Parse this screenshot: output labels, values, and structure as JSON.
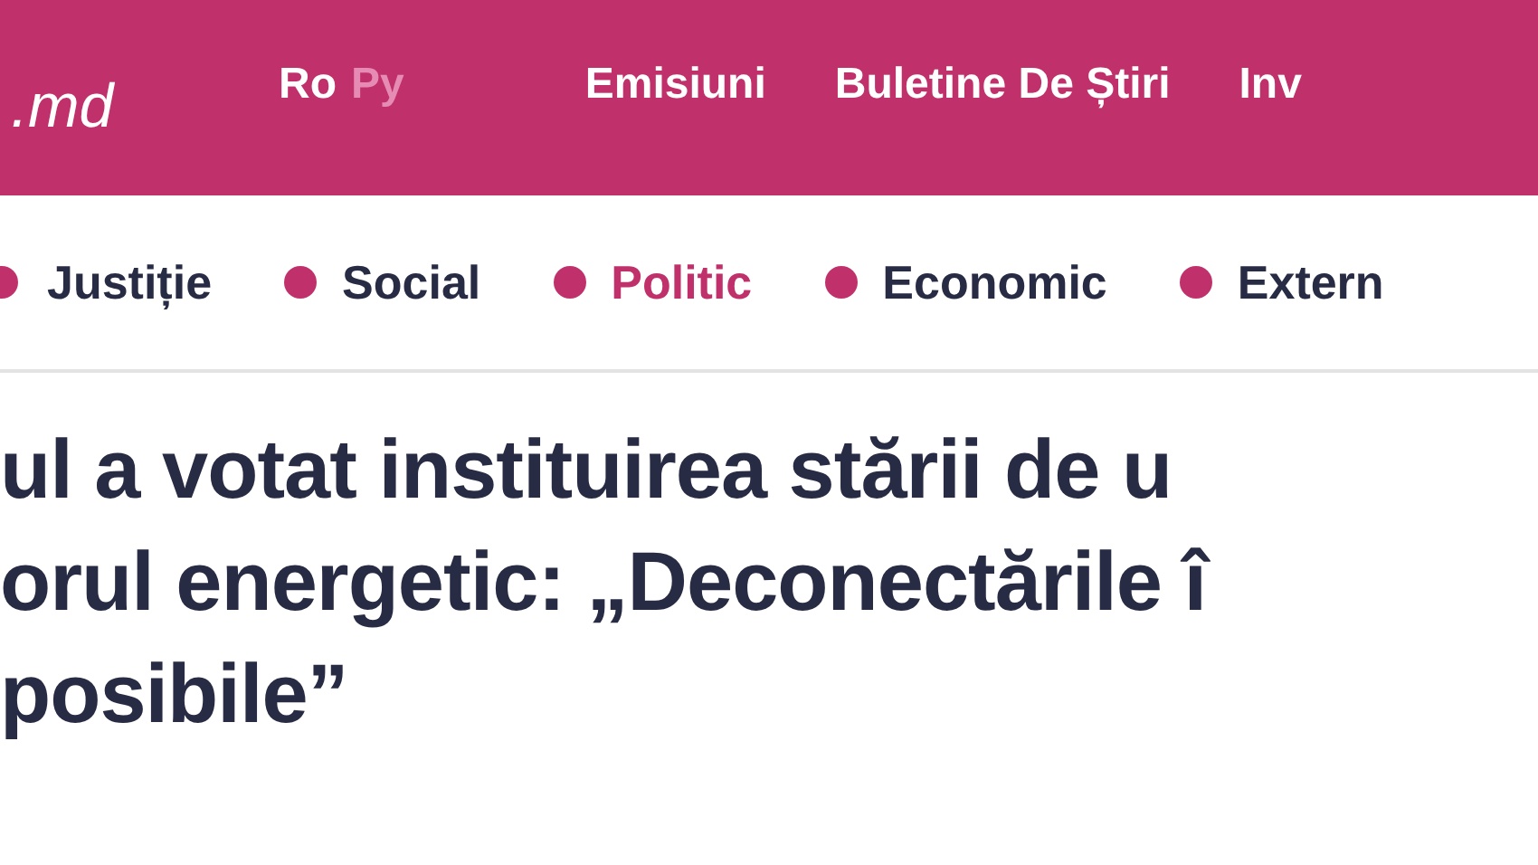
{
  "header": {
    "logo": ".md",
    "languages": [
      {
        "label": "Ro",
        "selected": true
      },
      {
        "label": "Py",
        "selected": false
      }
    ],
    "nav": [
      "Emisiuni",
      "Buletine De Știri",
      "Inv"
    ]
  },
  "categories": [
    {
      "label": "Justiție",
      "selected": false
    },
    {
      "label": "Social",
      "selected": false
    },
    {
      "label": "Politic",
      "selected": true
    },
    {
      "label": "Economic",
      "selected": false
    },
    {
      "label": "Extern",
      "selected": false
    }
  ],
  "headline": [
    "ul a votat instituirea stării de u",
    "orul energetic: „Deconectările î",
    "posibile”"
  ]
}
